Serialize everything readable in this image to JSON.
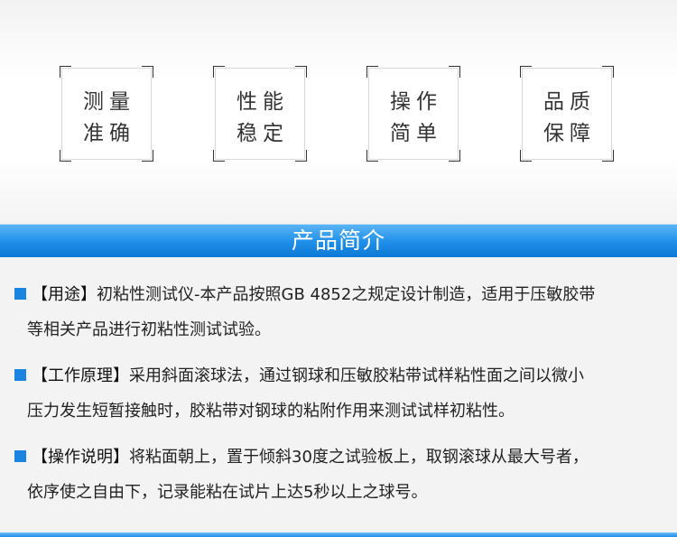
{
  "features": [
    {
      "line1": "测量",
      "line2": "准确"
    },
    {
      "line1": "性能",
      "line2": "稳定"
    },
    {
      "line1": "操作",
      "line2": "简单"
    },
    {
      "line1": "品质",
      "line2": "保障"
    }
  ],
  "banner": {
    "title": "产品简介"
  },
  "sections": [
    {
      "label": "【用途】",
      "text1": "初粘性测试仪-本产品按照GB 4852之规定设计制造，适用于压敏胶带",
      "text2": "等相关产品进行初粘性测试试验。"
    },
    {
      "label": "【工作原理】",
      "text1": "采用斜面滚球法，通过钢球和压敏胶粘带试样粘性面之间以微小",
      "text2": "压力发生短暂接触时，胶粘带对钢球的粘附作用来测试试样初粘性。"
    },
    {
      "label": "【操作说明】",
      "text1": "将粘面朝上，置于倾斜30度之试验板上，取钢滚球从最大号者，",
      "text2": "依序使之自由下，记录能粘在试片上达5秒以上之球号。"
    }
  ],
  "colors": {
    "accent": "#1a84e0",
    "banner": "#1e8ee8"
  }
}
